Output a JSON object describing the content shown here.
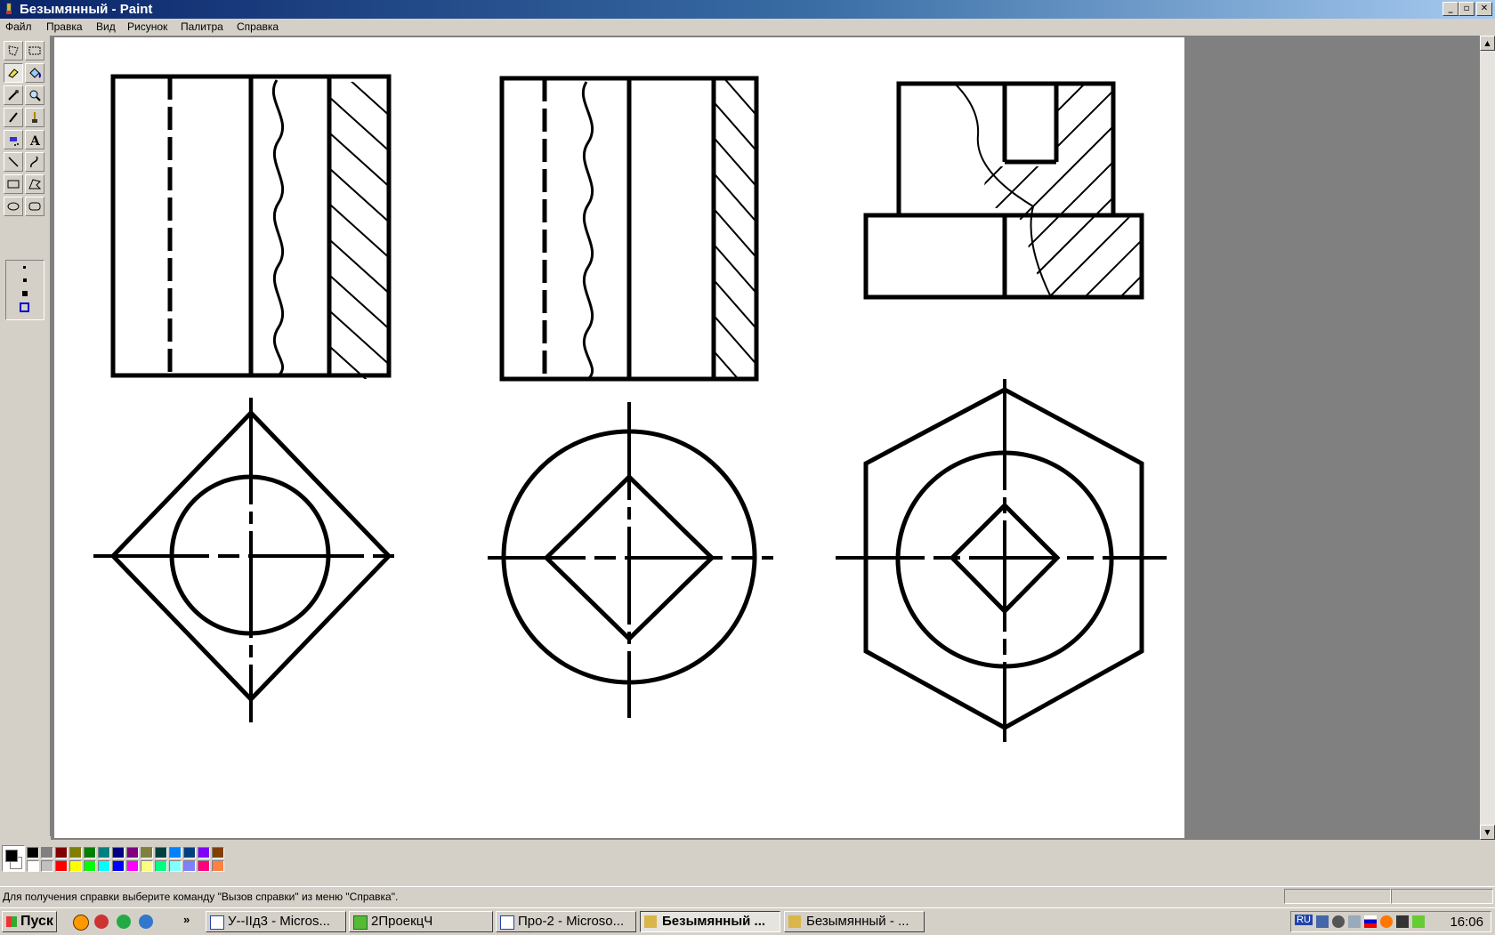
{
  "window": {
    "title": "Безымянный - Paint",
    "app_icon": "paint-icon"
  },
  "window_controls": [
    "minimize",
    "restore",
    "close"
  ],
  "menu": [
    "Файл",
    "Правка",
    "Вид",
    "Рисунок",
    "Палитра",
    "Справка"
  ],
  "tools": [
    {
      "name": "free-select",
      "icon": "free-form-select-icon"
    },
    {
      "name": "rect-select",
      "icon": "rect-select-icon"
    },
    {
      "name": "eraser",
      "icon": "eraser-icon",
      "active": true
    },
    {
      "name": "fill",
      "icon": "fill-bucket-icon"
    },
    {
      "name": "pick-color",
      "icon": "eyedropper-icon"
    },
    {
      "name": "magnifier",
      "icon": "magnifier-icon"
    },
    {
      "name": "pencil",
      "icon": "pencil-icon"
    },
    {
      "name": "brush",
      "icon": "brush-icon"
    },
    {
      "name": "airbrush",
      "icon": "airbrush-icon"
    },
    {
      "name": "text",
      "icon": "text-icon",
      "glyph": "A"
    },
    {
      "name": "line",
      "icon": "line-icon"
    },
    {
      "name": "curve",
      "icon": "curve-icon"
    },
    {
      "name": "rectangle",
      "icon": "rectangle-icon"
    },
    {
      "name": "polygon",
      "icon": "polygon-icon"
    },
    {
      "name": "ellipse",
      "icon": "ellipse-icon"
    },
    {
      "name": "rounded-rect",
      "icon": "rounded-rect-icon"
    }
  ],
  "palette": {
    "foreground": "#000000",
    "background": "#ffffff",
    "colors_top": [
      "#000000",
      "#808080",
      "#800000",
      "#808000",
      "#008000",
      "#008080",
      "#000080",
      "#800080",
      "#808040",
      "#004040",
      "#0080ff",
      "#004080",
      "#8000ff",
      "#804000"
    ],
    "colors_bottom": [
      "#ffffff",
      "#c0c0c0",
      "#ff0000",
      "#ffff00",
      "#00ff00",
      "#00ffff",
      "#0000ff",
      "#ff00ff",
      "#ffff80",
      "#00ff80",
      "#80ffff",
      "#8080ff",
      "#ff0080",
      "#ff8040"
    ]
  },
  "status": {
    "text": "Для получения справки выберите команду \"Вызов справки\" из меню \"Справка\"."
  },
  "taskbar": {
    "start_label": "Пуск",
    "quick_launch": [
      "browser-icon",
      "media-icon",
      "network-icon",
      "ie-icon"
    ],
    "more": "»",
    "tasks": [
      {
        "label": "У--ІІд3 - Micros...",
        "icon": "word-icon"
      },
      {
        "label": "2ПроекцЧ",
        "icon": "folder-icon"
      },
      {
        "label": "Про-2 - Microso...",
        "icon": "word-icon"
      },
      {
        "label": "Безымянный ...",
        "icon": "paint-icon",
        "active": true
      },
      {
        "label": "Безымянный - ...",
        "icon": "paint-icon"
      }
    ],
    "tray": {
      "lang": "RU",
      "time": "16:06"
    }
  }
}
